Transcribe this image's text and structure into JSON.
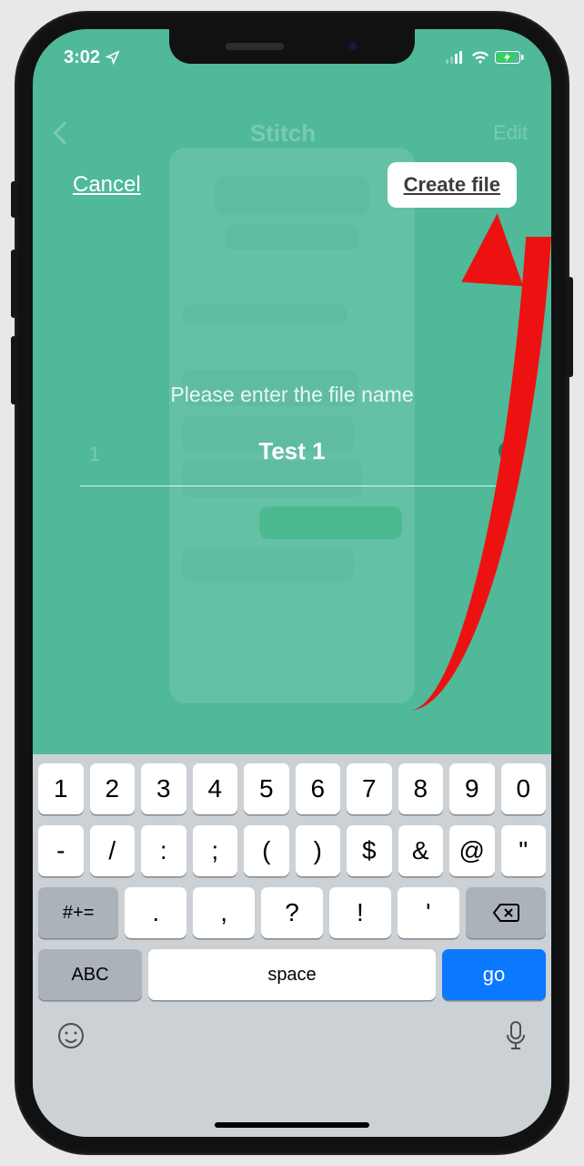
{
  "status": {
    "time": "3:02",
    "location_icon": "location-arrow-icon",
    "battery_charging": true
  },
  "bg_nav": {
    "title": "Stitch",
    "edit": "Edit"
  },
  "modal": {
    "cancel": "Cancel",
    "create": "Create file",
    "prompt": "Please enter the file name",
    "filename_value": "Test 1",
    "row_index": "1"
  },
  "keyboard": {
    "row1": [
      "1",
      "2",
      "3",
      "4",
      "5",
      "6",
      "7",
      "8",
      "9",
      "0"
    ],
    "row2": [
      "-",
      "/",
      ":",
      ";",
      "(",
      ")",
      "$",
      "&",
      "@",
      "\""
    ],
    "row3_switch": "#+=",
    "row3": [
      ".",
      ",",
      "?",
      "!",
      "'"
    ],
    "row4_abc": "ABC",
    "row4_space": "space",
    "row4_go": "go"
  }
}
